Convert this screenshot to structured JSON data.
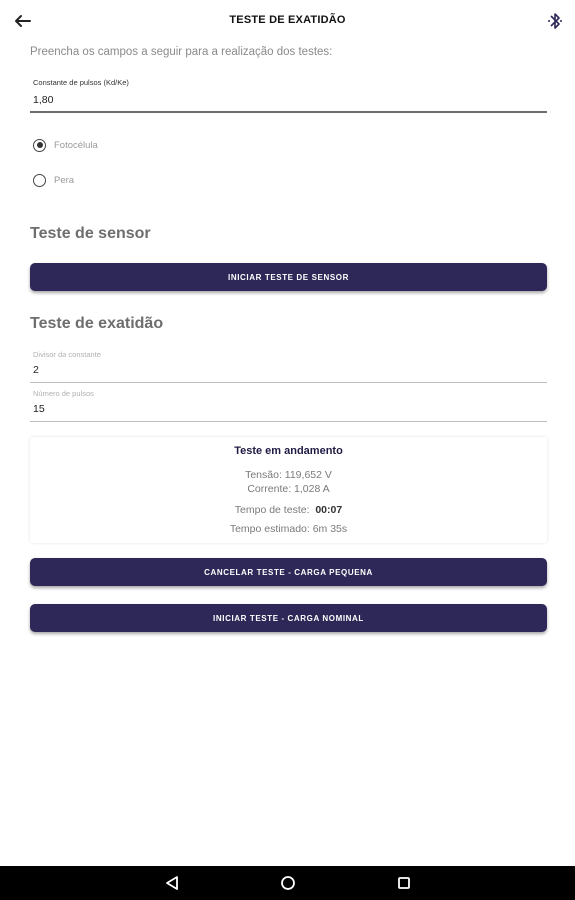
{
  "appbar": {
    "title": "TESTE DE EXATIDÃO",
    "back_icon": "arrow-left-icon",
    "bluetooth_icon": "bluetooth-icon"
  },
  "intro_text": "Preencha os campos a seguir para a realização dos testes:",
  "pulse_constant": {
    "label": "Constante de pulsos (Kd/Ke)",
    "value": "1,80"
  },
  "sensor_type": {
    "options": [
      {
        "label": "Fotocélula",
        "selected": true
      },
      {
        "label": "Pera",
        "selected": false
      }
    ]
  },
  "sensor_test": {
    "title": "Teste de sensor",
    "button_label": "INICIAR TESTE DE SENSOR"
  },
  "accuracy_test": {
    "title": "Teste de exatidão",
    "divisor": {
      "label": "Divisor da constante",
      "value": "2"
    },
    "pulses": {
      "label": "Número de pulsos",
      "value": "15"
    }
  },
  "status": {
    "title": "Teste em andamento",
    "voltage": "Tensão: 119,652 V",
    "current": "Corrente: 1,028 A",
    "test_time_label": "Tempo de teste:",
    "test_time_value": "00:07",
    "estimated_time": "Tempo estimado: 6m 35s"
  },
  "buttons": {
    "cancel_small_load": "CANCELAR TESTE - CARGA PEQUENA",
    "start_nominal_load": "INICIAR TESTE - CARGA NOMINAL"
  },
  "navbar": {
    "back_icon": "triangle-back-icon",
    "home_icon": "circle-home-icon",
    "recents_icon": "square-recents-icon"
  },
  "colors": {
    "primary": "#2d2857",
    "status_title": "#1f1b44",
    "navbar": "#000000"
  }
}
